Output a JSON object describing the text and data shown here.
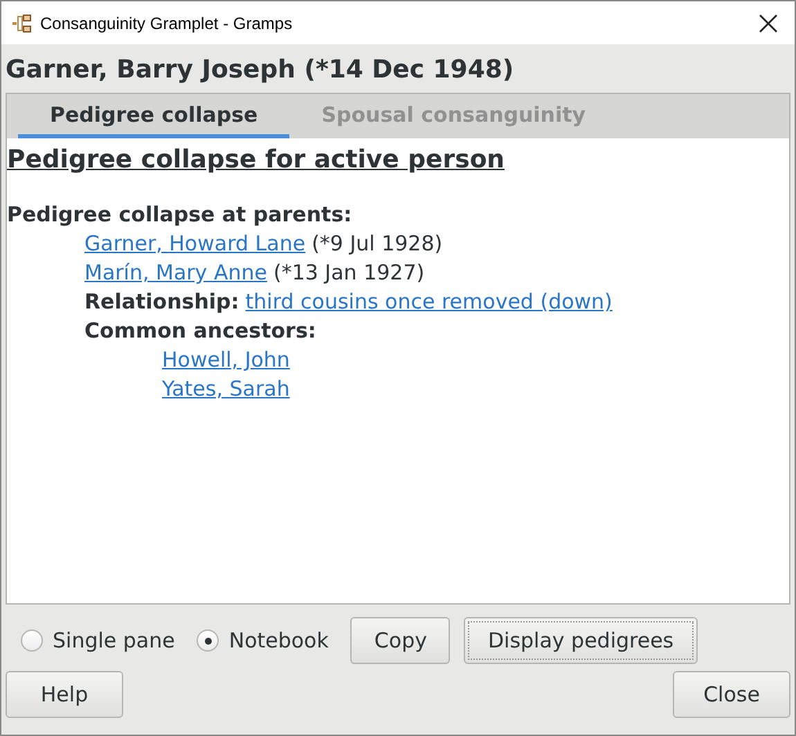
{
  "window": {
    "title": "Consanguinity Gramplet - Gramps"
  },
  "person_heading": "Garner, Barry Joseph (*14 Dec 1948)",
  "tabs": [
    {
      "label": "Pedigree collapse",
      "selected": true
    },
    {
      "label": "Spousal consanguinity",
      "selected": false
    }
  ],
  "content": {
    "title": "Pedigree collapse for active person",
    "section_label": "Pedigree collapse at parents:",
    "parents": [
      {
        "name": "Garner, Howard Lane",
        "date": "(*9 Jul 1928)"
      },
      {
        "name": "Marín, Mary Anne",
        "date": "(*13 Jan 1927)"
      }
    ],
    "relationship_label": "Relationship:",
    "relationship": "third cousins once removed (down)",
    "ancestors_label": "Common ancestors:",
    "ancestors": [
      "Howell, John",
      "Yates, Sarah"
    ]
  },
  "view_options": [
    {
      "label": "Single pane",
      "selected": false
    },
    {
      "label": "Notebook",
      "selected": true
    }
  ],
  "action_buttons": [
    "Copy",
    "Display pedigrees"
  ],
  "dialog_buttons": [
    "Help",
    "Close"
  ]
}
